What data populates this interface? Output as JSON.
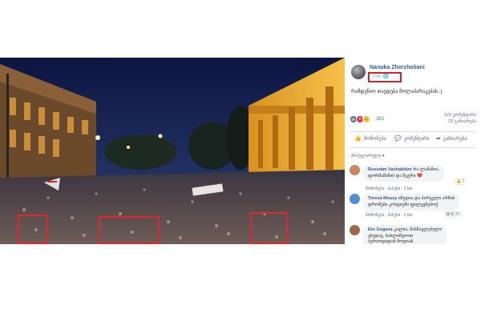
{
  "post": {
    "author": "Nanuka Zhorzholiani",
    "time": "2 სთ",
    "caption": "რამდენიო თავდება მოლაპარაკებას :)",
    "reactions": {
      "count": "901"
    },
    "comments_count": "123 კომენტარი",
    "shares_count": "23 გაზიარება",
    "actions": {
      "like": "მოწონება",
      "comment": "კომენტარი",
      "share": "გაზიარება"
    },
    "sort_label": "პოპულარული ▾"
  },
  "comments": [
    {
      "name": "Rusudan Vashakidze",
      "text_1": "რა ლამაზია,",
      "text_2": "ფორმაშინის და ზეგრი ❤️",
      "reaction_count": "7",
      "avatar_color": "#c9875f"
    },
    {
      "name": "Toresa Mossy",
      "text_1": "იმედია და პირველი არჩის",
      "text_2": "დროშები კოსტიუმი ფილყვნებოქ",
      "actions": "მოწონება · პასუხი · 2 სთ",
      "reaction_count": "21",
      "avatar_color": "#4d8fd1"
    },
    {
      "name": "Eto Gugava",
      "text_1": "კალია, მასწავლებელი",
      "text_2": "ვხედავ, სახლიშვიოთ",
      "text_3": "პერიოდიდან მოდიან",
      "avatar_color": "#9a6a4a"
    }
  ],
  "comment_actions": "მოწონება · პასუხი · 2 სთ",
  "colors": {
    "highlight": "#e2262f",
    "link": "#385898",
    "building_glow": "#f3b43a",
    "sky": "#1b2856"
  },
  "icons": [
    "globe-icon",
    "like-icon",
    "comment-icon",
    "share-icon"
  ]
}
